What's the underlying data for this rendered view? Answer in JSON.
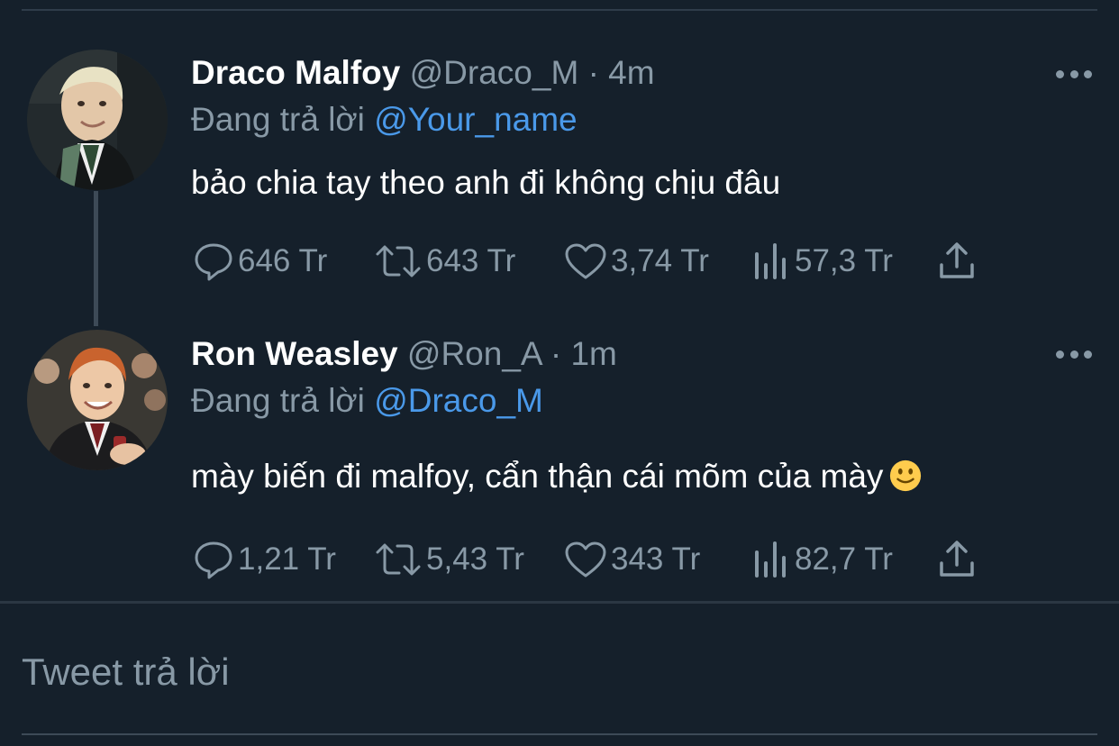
{
  "tweets": [
    {
      "display_name": "Draco Malfoy",
      "handle": "@Draco_M",
      "separator": "·",
      "time": "4m",
      "reply_prefix": "Đang trả lời",
      "reply_to": "@Your_name",
      "text": "bảo chia tay theo anh đi không chịu đâu",
      "has_emoji": false,
      "avatar_icon": "avatar-draco",
      "stats": {
        "replies": "646 Tr",
        "retweets": "643 Tr",
        "likes": "3,74 Tr",
        "views": "57,3 Tr"
      }
    },
    {
      "display_name": "Ron Weasley",
      "handle": "@Ron_A",
      "separator": "·",
      "time": "1m",
      "reply_prefix": "Đang trả lời",
      "reply_to": "@Draco_M",
      "text": "mày biến đi malfoy, cẩn thận cái mõm của mày",
      "has_emoji": true,
      "emoji_icon": "slightly-smiling-face",
      "avatar_icon": "avatar-ron",
      "stats": {
        "replies": "1,21 Tr",
        "retweets": "5,43 Tr",
        "likes": "343 Tr",
        "views": "82,7 Tr"
      }
    }
  ],
  "composer": {
    "placeholder": "Tweet trả lời"
  },
  "colors": {
    "background": "#15202b",
    "accent": "#4a99e9",
    "secondary_text": "#8899a6",
    "primary_text": "#ffffff",
    "divider": "#2f3c4a"
  }
}
